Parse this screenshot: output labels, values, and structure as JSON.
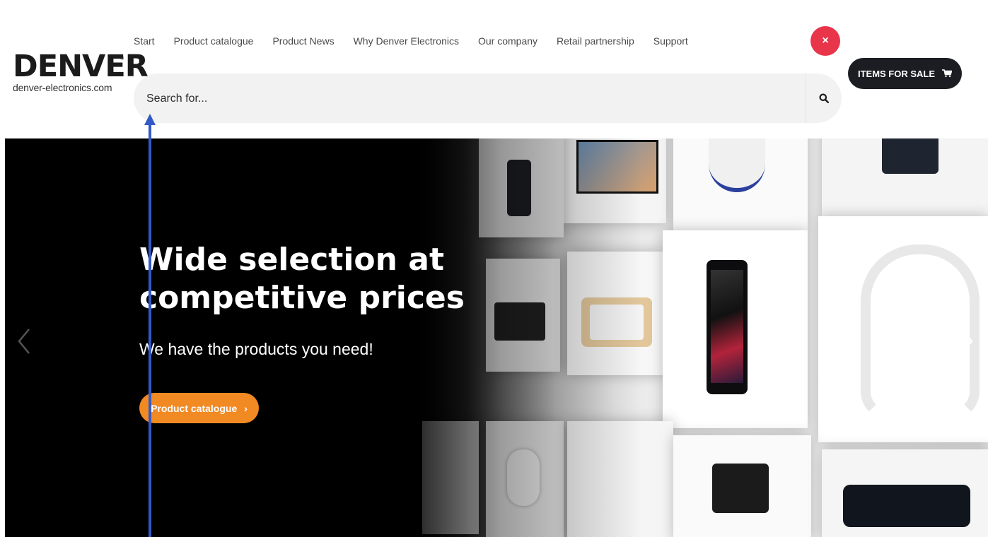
{
  "brand": {
    "name": "DENVER",
    "registered": "®",
    "url": "denver-electronics.com"
  },
  "nav": {
    "items": [
      {
        "label": "Start"
      },
      {
        "label": "Product catalogue"
      },
      {
        "label": "Product News"
      },
      {
        "label": "Why Denver Electronics"
      },
      {
        "label": "Our company"
      },
      {
        "label": "Retail partnership"
      },
      {
        "label": "Support"
      }
    ]
  },
  "search": {
    "placeholder": "Search for...",
    "icon": "search-icon"
  },
  "close": {
    "label": "×",
    "icon": "close-icon"
  },
  "sale_button": {
    "label": "ITEMS FOR SALE",
    "icon": "cart-icon"
  },
  "hero": {
    "headline_line1": "Wide selection at",
    "headline_line2": "competitive prices",
    "subline": "We have the products you need!",
    "cta_label": "Product catalogue",
    "cta_chevron": "›",
    "prev_icon": "chevron-left-icon",
    "next_icon": "chevron-right-icon"
  },
  "colors": {
    "accent_orange": "#f28a24",
    "close_red": "#e8354a",
    "dark_button": "#1b1d22",
    "search_bg": "#f1f2f1",
    "pointer_blue": "#3259c6"
  }
}
